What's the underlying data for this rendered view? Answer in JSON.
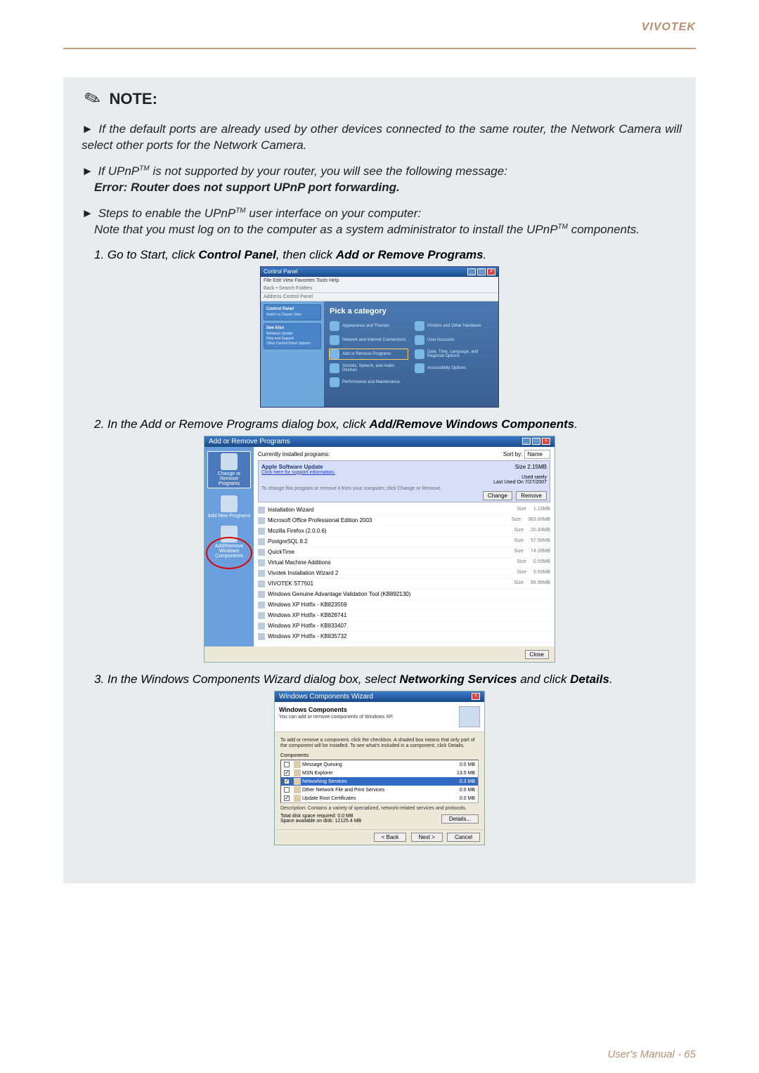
{
  "brand": "VIVOTEK",
  "note_label": "NOTE:",
  "bullets": {
    "b1_a": "If the default ports are already used by other devices connected to the same router, the Network Camera will select other ports for the Network Camera.",
    "b2_a": "If UPnP",
    "b2_tm": "TM",
    "b2_b": " is not supported by your router, you will see the following message:",
    "b2_err": "Error: Router does not support UPnP port forwarding.",
    "b3_a": "Steps to enable the UPnP",
    "b3_tm": "TM",
    "b3_b": " user interface on your computer:",
    "b3_note_a": "Note that you must log on to the computer as a system administrator to install the UPnP",
    "b3_note_tm": "TM",
    "b3_note_b": " components."
  },
  "steps": {
    "s1_a": "1. Go to Start, click ",
    "s1_b": "Control Panel",
    "s1_c": ", then click ",
    "s1_d": "Add or Remove Programs",
    "s1_e": ".",
    "s2_a": "2. In the Add or Remove Programs dialog box, click ",
    "s2_b": "Add/Remove Windows Components",
    "s2_c": ".",
    "s3_a": "3. In the Windows Components Wizard dialog box, select ",
    "s3_b": "Networking Services",
    "s3_c": " and click ",
    "s3_d": "Details",
    "s3_e": "."
  },
  "cp": {
    "title": "Control Panel",
    "menu": "File   Edit   View   Favorites   Tools   Help",
    "toolbar": "Back   •   Search   Folders",
    "address": "Address   Control Panel",
    "side_panel1_title": "Control Panel",
    "side_panel1_item": "Switch to Classic View",
    "side_panel2_title": "See Also",
    "side_panel2_items": [
      "Windows Update",
      "Help and Support",
      "Other Control Panel Options"
    ],
    "heading": "Pick a category",
    "cats": [
      "Appearance and Themes",
      "Printers and Other Hardware",
      "Network and Internet Connections",
      "User Accounts",
      "Add or Remove Programs",
      "Date, Time, Language, and Regional Options",
      "Sounds, Speech, and Audio Devices",
      "Accessibility Options",
      "Performance and Maintenance",
      ""
    ]
  },
  "arp": {
    "title": "Add or Remove Programs",
    "side": {
      "change": "Change or Remove Programs",
      "add_new": "Add New Programs",
      "add_win": "Add/Remove Windows Components"
    },
    "top_label": "Currently installed programs:",
    "sort_label": "Sort by:",
    "sort_value": "Name",
    "selected": {
      "name": "Apple Software Update",
      "link": "Click here for support information.",
      "change_text": "To change this program or remove it from your computer, click Change or Remove.",
      "size_label": "Size",
      "size_value": "2.15MB",
      "used_label": "Used",
      "used_value": "rarely",
      "last_label": "Last Used On",
      "last_value": "7/27/2007",
      "btn_change": "Change",
      "btn_remove": "Remove"
    },
    "rows": [
      {
        "name": "Installation Wizard",
        "size_l": "Size",
        "size": "1.10MB"
      },
      {
        "name": "Microsoft Office Professional Edition 2003",
        "size_l": "Size",
        "size": "383.00MB"
      },
      {
        "name": "Mozilla Firefox (2.0.0.6)",
        "size_l": "Size",
        "size": "20.34MB"
      },
      {
        "name": "PostgreSQL 8.2",
        "size_l": "Size",
        "size": "57.50MB"
      },
      {
        "name": "QuickTime",
        "size_l": "Size",
        "size": "74.39MB"
      },
      {
        "name": "Virtual Machine Additions",
        "size_l": "Size",
        "size": "0.93MB"
      },
      {
        "name": "Vivotek Installation Wizard 2",
        "size_l": "Size",
        "size": "5.50MB"
      },
      {
        "name": "VIVOTEK ST7501",
        "size_l": "Size",
        "size": "66.96MB"
      },
      {
        "name": "Windows Genuine Advantage Validation Tool (KB892130)",
        "size_l": "",
        "size": ""
      },
      {
        "name": "Windows XP Hotfix - KB823559",
        "size_l": "",
        "size": ""
      },
      {
        "name": "Windows XP Hotfix - KB828741",
        "size_l": "",
        "size": ""
      },
      {
        "name": "Windows XP Hotfix - KB833407",
        "size_l": "",
        "size": ""
      },
      {
        "name": "Windows XP Hotfix - KB835732",
        "size_l": "",
        "size": ""
      }
    ],
    "close": "Close"
  },
  "wcw": {
    "title": "Windows Components Wizard",
    "head_title": "Windows Components",
    "head_sub": "You can add or remove components of Windows XP.",
    "instr": "To add or remove a component, click the checkbox. A shaded box means that only part of the component will be installed. To see what's included in a component, click Details.",
    "comp_label": "Components:",
    "items": [
      {
        "name": "Message Queuing",
        "size": "0.0 MB",
        "checked": false
      },
      {
        "name": "MSN Explorer",
        "size": "13.5 MB",
        "checked": true
      },
      {
        "name": "Networking Services",
        "size": "0.3 MB",
        "checked": true,
        "selected": true
      },
      {
        "name": "Other Network File and Print Services",
        "size": "0.0 MB",
        "checked": false
      },
      {
        "name": "Update Root Certificates",
        "size": "0.0 MB",
        "checked": true
      }
    ],
    "desc_label": "Description:",
    "desc": "Contains a variety of specialized, network-related services and protocols.",
    "space_req_label": "Total disk space required:",
    "space_req": "0.0 MB",
    "space_avail_label": "Space available on disk:",
    "space_avail": "12125.4 MB",
    "details_btn": "Details...",
    "back": "< Back",
    "next": "Next >",
    "cancel": "Cancel"
  },
  "footer": "User's Manual - 65"
}
